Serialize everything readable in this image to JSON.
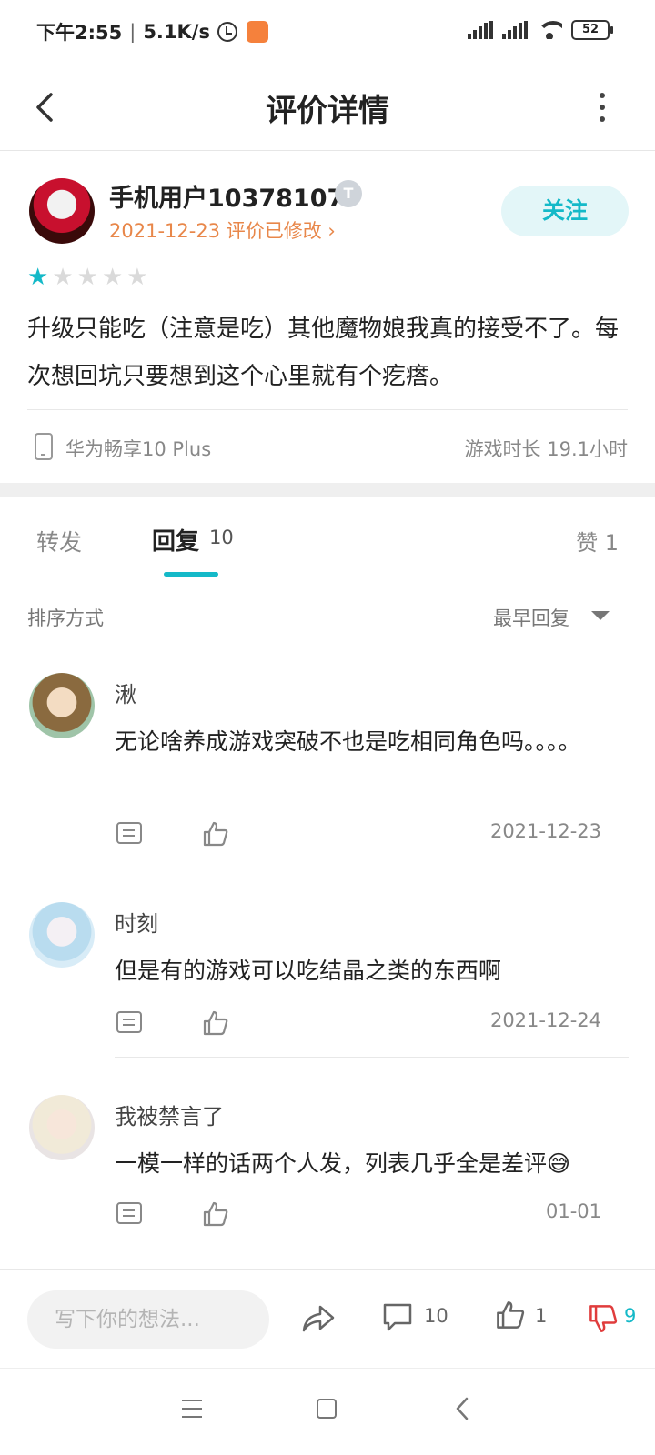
{
  "status_bar": {
    "time": "下午2:55",
    "network_speed": "5.1K/s",
    "battery": "52"
  },
  "header": {
    "title": "评价详情"
  },
  "review": {
    "author": "手机用户10378107",
    "badge": "T",
    "date": "2021-12-23 评价已修改",
    "follow_label": "关注",
    "rating": 1,
    "rating_max": 5,
    "text": "升级只能吃（注意是吃）其他魔物娘我真的接受不了。每次想回坑只要想到这个心里就有个疙瘩。",
    "device": "华为畅享10 Plus",
    "play_time": "游戏时长 19.1小时"
  },
  "tabs": {
    "forward": "转发",
    "reply": "回复",
    "reply_count": "10",
    "like": "赞 1"
  },
  "sort": {
    "label": "排序方式",
    "value": "最早回复"
  },
  "comments": [
    {
      "name": "湫",
      "text": "无论啥养成游戏突破不也是吃相同角色吗。。。。",
      "date": "2021-12-23"
    },
    {
      "name": "时刻",
      "text": "但是有的游戏可以吃结晶之类的东西啊",
      "date": "2021-12-24"
    },
    {
      "name": "我被禁言了",
      "text": "一模一样的话两个人发，列表几乎全是差评😅",
      "date": "01-01"
    }
  ],
  "bottom_bar": {
    "input_placeholder": "写下你的想法...",
    "comment_count": "10",
    "like_count": "1",
    "dislike_count": "9"
  },
  "colors": {
    "accent": "#14b9c8",
    "date_orange": "#e8874a",
    "dislike_red": "#e03c3c"
  }
}
